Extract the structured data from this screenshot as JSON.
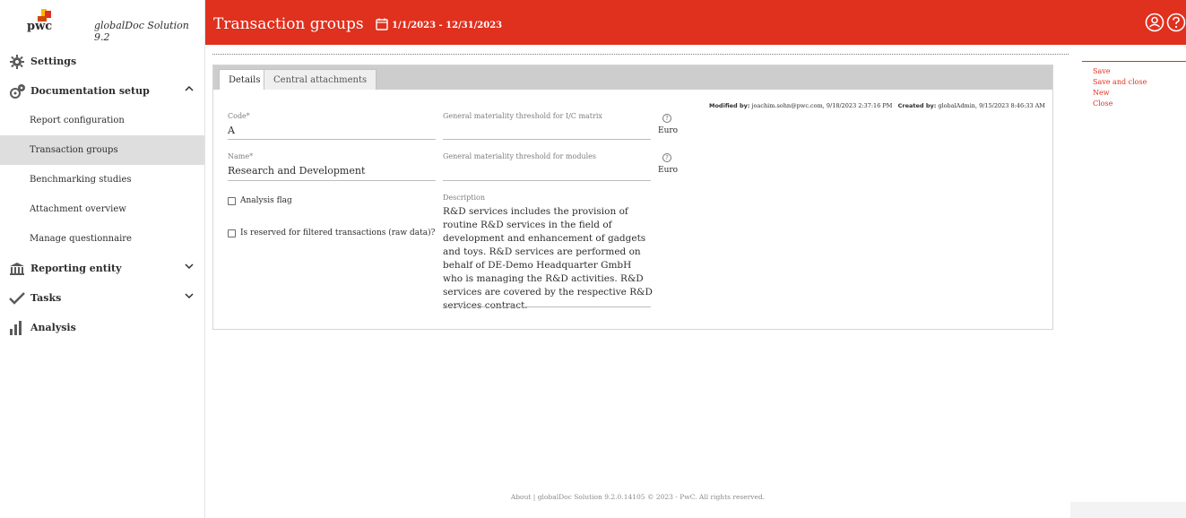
{
  "brand": {
    "logo_text": "pwc",
    "product_name": "globalDoc Solution 9.2"
  },
  "sidebar": {
    "settings": "Settings",
    "documentation_setup": "Documentation setup",
    "sub_items": [
      "Report configuration",
      "Transaction groups",
      "Benchmarking studies",
      "Attachment overview",
      "Manage questionnaire"
    ],
    "reporting_entity": "Reporting entity",
    "tasks": "Tasks",
    "analysis": "Analysis"
  },
  "header": {
    "title": "Transaction groups",
    "date_range": "1/1/2023 - 12/31/2023"
  },
  "tabs": [
    "Details",
    "Central attachments"
  ],
  "form": {
    "code_label": "Code*",
    "code_value": "A",
    "name_label": "Name*",
    "name_value": "Research and Development",
    "threshold_ic_label": "General materiality threshold for I/C matrix",
    "threshold_modules_label": "General materiality threshold for modules",
    "unit": "Euro",
    "help_glyph": "?",
    "analysis_flag": "Analysis flag",
    "reserved_flag": "Is reserved for filtered transactions (raw data)?",
    "description_label": "Description",
    "description_value": "R&D services includes the provision of routine R&D services in the field of development and enhancement of gadgets and toys. R&D services are performed on behalf of DE-Demo Headquarter GmbH who is managing the R&D activities. R&D services are covered by the respective R&D services contract."
  },
  "meta": {
    "modified_label": "Modified by:",
    "modified_value": "joachim.sohn@pwc.com, 9/18/2023 2:37:16 PM",
    "created_label": "Created by:",
    "created_value": "globalAdmin, 9/15/2023 8:46:33 AM"
  },
  "actions": [
    "Save",
    "Save and close",
    "New",
    "Close"
  ],
  "footer": "About |  globalDoc Solution 9.2.0.14105  © 2023 - PwC. All rights reserved.",
  "colors": {
    "brand_red": "#e0301e",
    "active_nav": "#dedede"
  },
  "icons": {
    "settings": "gear-icon",
    "documentation": "gears-icon",
    "reporting": "bank-icon",
    "tasks": "checkmark-icon",
    "analysis": "bar-chart-icon",
    "user": "user-icon",
    "help": "help-icon",
    "calendar": "calendar-icon"
  }
}
